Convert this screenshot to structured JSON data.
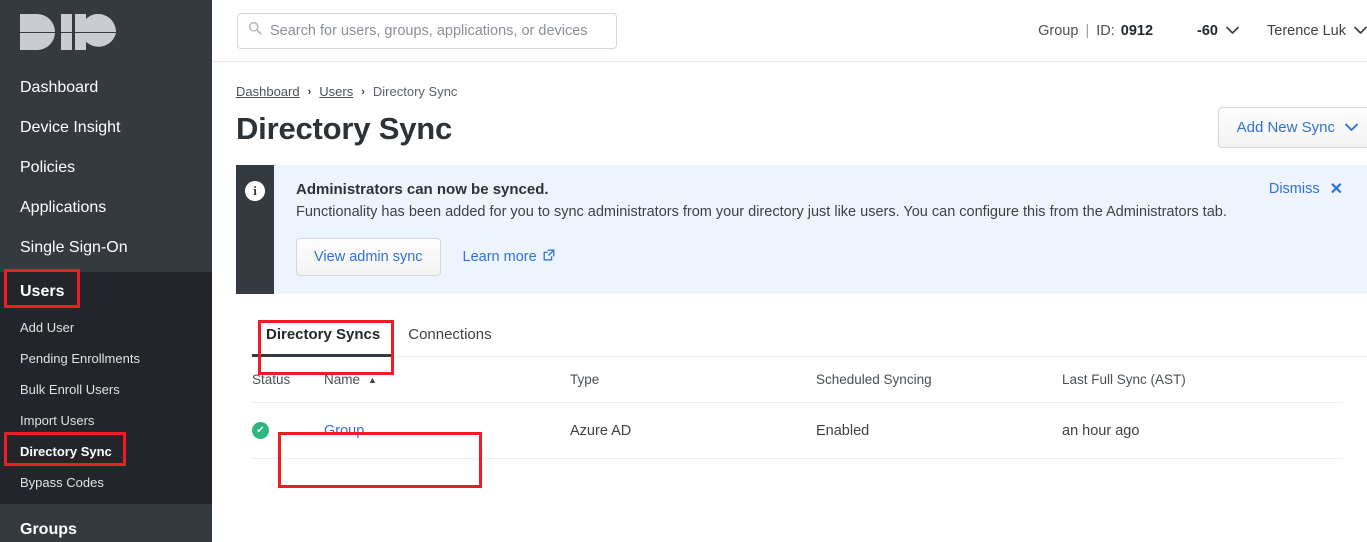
{
  "brand": {
    "logo_name": "duo-logo",
    "logo_text": "DUO"
  },
  "search": {
    "placeholder": "Search for users, groups, applications, or devices",
    "value": "",
    "icon": "search-icon"
  },
  "account": {
    "label": "Group",
    "separator": "|",
    "id_label": "ID:",
    "id_value": "0912",
    "id_tail": "-60",
    "chevron": "⌄",
    "user_name": "Terence Luk",
    "user_chevron": "⌄"
  },
  "sidebar": {
    "items": [
      {
        "label": "Dashboard",
        "name": "dashboard"
      },
      {
        "label": "Device Insight",
        "name": "device-insight"
      },
      {
        "label": "Policies",
        "name": "policies"
      },
      {
        "label": "Applications",
        "name": "applications"
      },
      {
        "label": "Single Sign-On",
        "name": "single-sign-on"
      }
    ],
    "users_section": {
      "label": "Users",
      "sub_items": [
        {
          "label": "Add User",
          "name": "add-user"
        },
        {
          "label": "Pending Enrollments",
          "name": "pending-enrollments"
        },
        {
          "label": "Bulk Enroll Users",
          "name": "bulk-enroll-users"
        },
        {
          "label": "Import Users",
          "name": "import-users"
        },
        {
          "label": "Directory Sync",
          "name": "directory-sync",
          "current": true
        },
        {
          "label": "Bypass Codes",
          "name": "bypass-codes"
        }
      ]
    },
    "groups_section": {
      "label": "Groups"
    }
  },
  "breadcrumb": {
    "items": [
      {
        "label": "Dashboard",
        "link": true
      },
      {
        "label": "Users",
        "link": true
      },
      {
        "label": "Directory Sync",
        "link": false
      }
    ],
    "separator": "›"
  },
  "page": {
    "title": "Directory Sync",
    "add_new_sync": "Add New Sync",
    "add_new_sync_chevron": "⌄"
  },
  "banner": {
    "icon": "info-icon",
    "icon_glyph": "i",
    "title": "Administrators can now be synced.",
    "text": "Functionality has been added for you to sync administrators from your directory just like users. You can configure this from the Administrators tab.",
    "primary_button": "View admin sync",
    "learn_more": "Learn more",
    "learn_more_icon": "external-link-icon",
    "dismiss": "Dismiss",
    "dismiss_icon": "close-icon",
    "dismiss_glyph": "✕"
  },
  "tabs": [
    {
      "label": "Directory Syncs",
      "name": "directory-syncs",
      "active": true
    },
    {
      "label": "Connections",
      "name": "connections",
      "active": false
    }
  ],
  "table": {
    "columns": [
      {
        "key": "status",
        "label": "Status"
      },
      {
        "key": "name",
        "label": "Name",
        "sorted": "asc",
        "sort_glyph": "▲"
      },
      {
        "key": "type",
        "label": "Type"
      },
      {
        "key": "scheduled",
        "label": "Scheduled Syncing"
      },
      {
        "key": "last_full_sync",
        "label": "Last Full Sync (AST)"
      }
    ],
    "rows": [
      {
        "status_icon": "status-ok-icon",
        "status_glyph": "✔",
        "name": "Group",
        "type": "Azure AD",
        "scheduled": "Enabled",
        "last_full_sync": "an hour ago"
      }
    ]
  },
  "colors": {
    "sidebar_bg": "#343a40",
    "sidebar_section_bg": "#22262b",
    "link_blue": "#2f72d4",
    "banner_bg": "#eef4fd",
    "status_green": "#2fb67c",
    "annotation_red": "#ee1c25"
  },
  "annotations": [
    {
      "name": "highlight-users-nav"
    },
    {
      "name": "highlight-directory-sync-nav"
    },
    {
      "name": "highlight-directory-syncs-tab"
    },
    {
      "name": "highlight-group-sync-row"
    }
  ]
}
